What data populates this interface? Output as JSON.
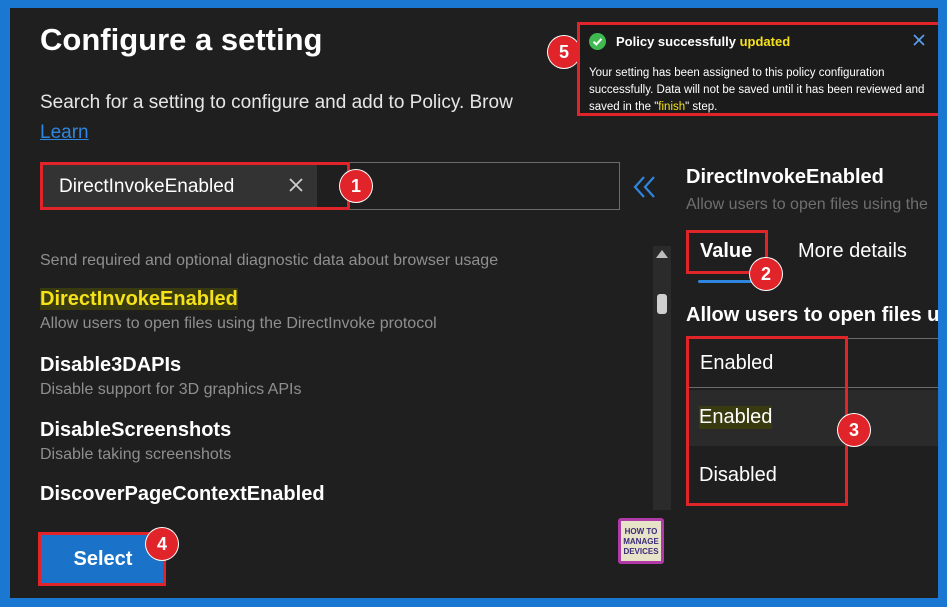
{
  "header": {
    "title": "Configure a setting",
    "description": "Search for a setting to configure and add to Policy. Brow",
    "learn_link": "Learn"
  },
  "search": {
    "value": "DirectInvokeEnabled"
  },
  "settings_list": {
    "partial_top_desc": "Send required and optional diagnostic data about browser usage",
    "items": [
      {
        "title": "DirectInvokeEnabled",
        "desc": "Allow users to open files using the DirectInvoke protocol"
      },
      {
        "title": "Disable3DAPIs",
        "desc": "Disable support for 3D graphics APIs"
      },
      {
        "title": "DisableScreenshots",
        "desc": "Disable taking screenshots"
      },
      {
        "title": "DiscoverPageContextEnabled",
        "desc": ""
      }
    ]
  },
  "select_button": "Select",
  "logo": {
    "line1": "HOW TO",
    "line2": "MANAGE",
    "line3": "DEVICES"
  },
  "detail_panel": {
    "title": "DirectInvokeEnabled",
    "description": "Allow users to open files using the",
    "tabs": [
      {
        "label": "Value",
        "active": true
      },
      {
        "label": "More details",
        "active": false
      }
    ],
    "setting_label": "Allow users to open files u",
    "dropdown": {
      "selected": "Enabled",
      "options": [
        "Enabled",
        "Disabled"
      ]
    }
  },
  "toast": {
    "title_prefix": "Policy successfully ",
    "title_highlight": "updated",
    "body_prefix": "Your setting has been assigned to this policy configuration successfully. Data will not be saved until it has been reviewed and saved in the \"",
    "body_highlight": "finish",
    "body_suffix": "\" step."
  },
  "annotations": [
    "1",
    "2",
    "3",
    "4",
    "5"
  ],
  "colors": {
    "accent": "#1a73c8",
    "annotation_red": "#e0242a",
    "highlight_yellow": "#f5e21a",
    "success_green": "#3fb950"
  }
}
